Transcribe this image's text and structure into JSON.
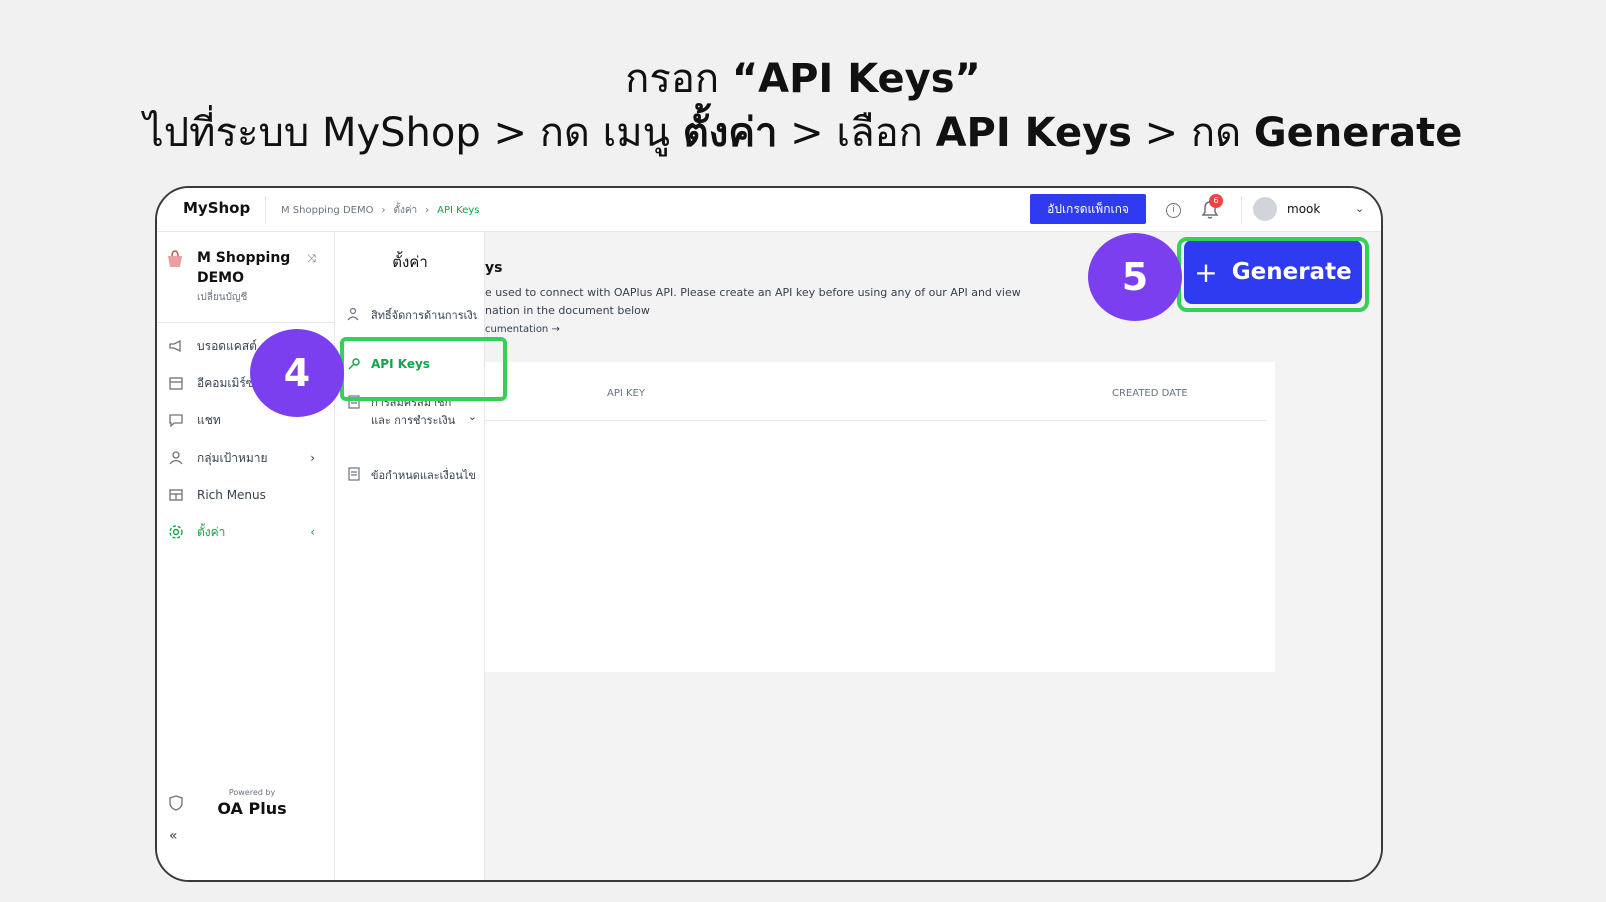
{
  "instructions": {
    "line1_prefix": "กรอก ",
    "line1_bold": "“API Keys”",
    "line2": [
      {
        "text": "ไปที่ระบบ MyShop > กด เมนู ",
        "bold": false
      },
      {
        "text": "ตั้งค่า",
        "bold": true
      },
      {
        "text": " > เลือก ",
        "bold": false
      },
      {
        "text": "API Keys",
        "bold": true
      },
      {
        "text": " > กด ",
        "bold": false
      },
      {
        "text": "Generate",
        "bold": true
      }
    ]
  },
  "topbar": {
    "brand": "MyShop",
    "breadcrumbs": [
      "M Shopping DEMO",
      "ตั้งค่า",
      "API Keys"
    ],
    "upgrade_label": "อัปเกรดแพ็กเกจ",
    "notification_count": "6",
    "user_name": "mook"
  },
  "sidebar": {
    "shop_name": "M Shopping DEMO",
    "switch_account": "เปลี่ยนบัญชี",
    "items": [
      {
        "label": "บรอดแคสต์",
        "icon": "megaphone-icon"
      },
      {
        "label": "อีคอมเมิร์ซ",
        "icon": "store-icon"
      },
      {
        "label": "แชท",
        "icon": "chat-icon"
      },
      {
        "label": "กลุ่มเป้าหมาย",
        "icon": "user-icon"
      },
      {
        "label": "Rich Menus",
        "icon": "layout-icon"
      },
      {
        "label": "ตั้งค่า",
        "icon": "gear-icon"
      }
    ],
    "powered_by": "Powered by",
    "powered_logo": "OA Plus"
  },
  "submenu": {
    "title": "ตั้งค่า",
    "items": [
      {
        "label": "สิทธิ์จัดการด้านการเงิน"
      },
      {
        "label": "API Keys"
      },
      {
        "label": "การสมัครสมาชิกและ การชำระเงิน"
      },
      {
        "label": "ข้อกำหนดและเงื่อนไข"
      }
    ]
  },
  "content": {
    "title_fragment": "ys",
    "description": "e used to connect with OAPlus API. Please create an API key before using any of our API and view nation in the document below",
    "doc_link": "cumentation →",
    "table_headers": [
      "API KEY",
      "CREATED DATE"
    ]
  },
  "annotations": {
    "step4": "4",
    "step5": "5"
  },
  "generate_label": "Generate",
  "colors": {
    "accent_blue": "#2e3bf1",
    "highlight_green": "#35d05a",
    "step_purple": "#7b3ff0",
    "active_green": "#16a34a"
  }
}
